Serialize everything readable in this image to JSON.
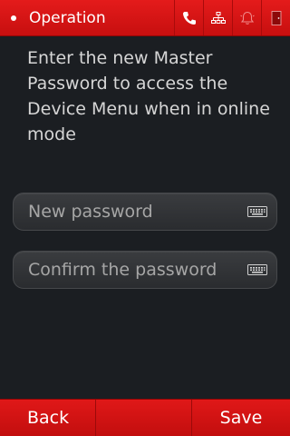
{
  "header": {
    "title": "Operation",
    "icons": [
      "status-dot",
      "phone-icon",
      "network-icon",
      "alarm-bell-icon",
      "door-exit-icon"
    ]
  },
  "instructions": "Enter the new Master Password to access the Device Menu when in online mode",
  "fields": {
    "new_password": {
      "placeholder": "New password",
      "value": "",
      "icon": "keyboard-icon"
    },
    "confirm_password": {
      "placeholder": "Confirm the password",
      "value": "",
      "icon": "keyboard-icon"
    }
  },
  "footer": {
    "back_label": "Back",
    "save_label": "Save"
  },
  "colors": {
    "accent_red": "#d81414",
    "background": "#1b1e22",
    "text": "#d6d6d6",
    "placeholder": "#a6a6a6"
  }
}
